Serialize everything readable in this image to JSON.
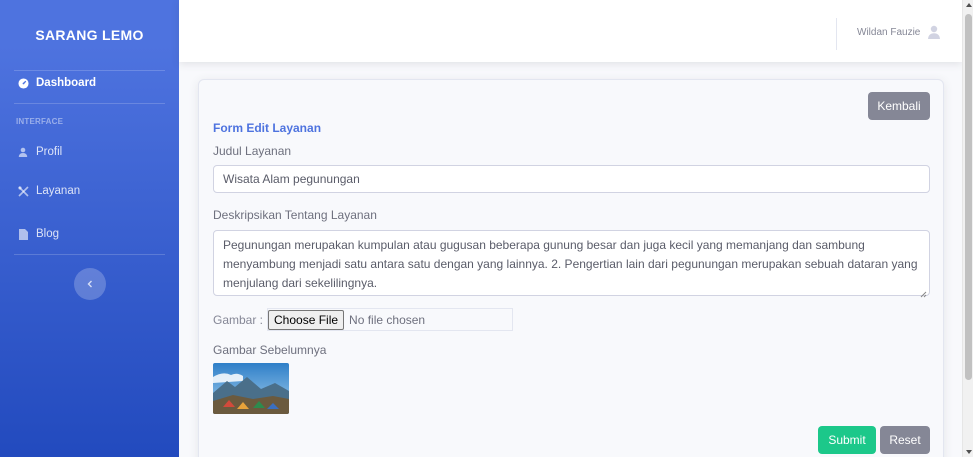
{
  "sidebar": {
    "brand": "SARANG LEMO",
    "dashboard": "Dashboard",
    "heading": "INTERFACE",
    "items": [
      {
        "label": "Profil",
        "icon": "user-icon"
      },
      {
        "label": "Layanan",
        "icon": "tools-icon"
      },
      {
        "label": "Blog",
        "icon": "file-icon"
      }
    ],
    "toggle_icon": "chevron-left-icon"
  },
  "topbar": {
    "user_name": "Wildan Fauzie",
    "user_icon": "user-avatar-icon"
  },
  "form": {
    "back_label": "Kembali",
    "title": "Form Edit Layanan",
    "judul_label": "Judul Layanan",
    "judul_value": "Wisata Alam pegunungan",
    "deskripsi_label": "Deskripsikan Tentang Layanan",
    "deskripsi_value": "Pegunungan merupakan kumpulan atau gugusan beberapa gunung besar dan juga kecil yang memanjang dan sambung menyambung menjadi satu antara satu dengan yang lainnya. 2. Pengertian lain dari pegunungan merupakan sebuah dataran yang menjulang dari sekelilingnya.",
    "gambar_label": "Gambar :",
    "choose_file": "Choose File",
    "file_status": "No file chosen",
    "previous_label": "Gambar Sebelumnya",
    "submit_label": "Submit",
    "reset_label": "Reset"
  },
  "colors": {
    "primary": "#4e73df",
    "secondary": "#858796",
    "success": "#1cc88a"
  }
}
